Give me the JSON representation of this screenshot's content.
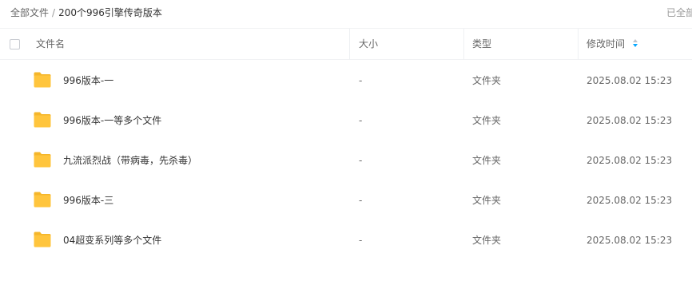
{
  "breadcrumb": {
    "root": "全部文件",
    "separator": "/",
    "current": "200个996引擎传奇版本"
  },
  "selected_status": "已全部",
  "columns": {
    "name": "文件名",
    "size": "大小",
    "type": "类型",
    "modified": "修改时间"
  },
  "sort": {
    "column": "modified",
    "direction": "descending"
  },
  "colors": {
    "accent": "#06a7ff",
    "folder": "#ffc53d"
  },
  "files": [
    {
      "icon": "folder-icon",
      "name": "996版本-一",
      "size": "-",
      "type": "文件夹",
      "modified": "2025.08.02 15:23"
    },
    {
      "icon": "folder-icon",
      "name": "996版本-一等多个文件",
      "size": "-",
      "type": "文件夹",
      "modified": "2025.08.02 15:23"
    },
    {
      "icon": "folder-icon",
      "name": "九流派烈战（带病毒，先杀毒）",
      "size": "-",
      "type": "文件夹",
      "modified": "2025.08.02 15:23"
    },
    {
      "icon": "folder-icon",
      "name": "996版本-三",
      "size": "-",
      "type": "文件夹",
      "modified": "2025.08.02 15:23"
    },
    {
      "icon": "folder-icon",
      "name": "04超变系列等多个文件",
      "size": "-",
      "type": "文件夹",
      "modified": "2025.08.02 15:23"
    }
  ]
}
